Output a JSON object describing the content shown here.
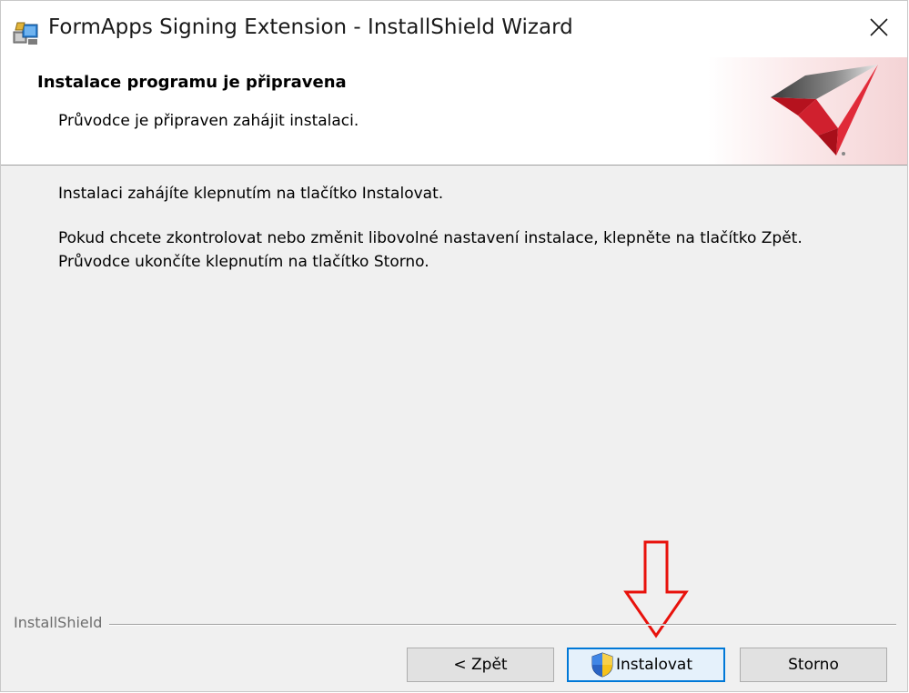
{
  "window": {
    "title": "FormApps Signing Extension - InstallShield Wizard",
    "app_icon": "installer-icon",
    "close_icon": "close-icon"
  },
  "banner": {
    "title": "Instalace programu je připravena",
    "subtitle": "Průvodce je připraven zahájit instalaci.",
    "logo": "installshield-logo"
  },
  "content": {
    "paragraph1": "Instalaci zahájíte klepnutím na tlačítko Instalovat.",
    "paragraph2_line1": "Pokud chcete zkontrolovat nebo změnit libovolné nastavení instalace, klepněte na tlačítko Zpět.",
    "paragraph2_line2": "Průvodce ukončíte klepnutím na tlačítko Storno."
  },
  "footer": {
    "brand_label": "InstallShield"
  },
  "buttons": {
    "back_label": "< Zpět",
    "install_label": "Instalovat",
    "install_icon": "uac-shield-icon",
    "cancel_label": "Storno"
  },
  "annotation": {
    "arrow_icon": "down-arrow-icon",
    "arrow_color": "#e8120c"
  },
  "colors": {
    "accent": "#0078d7",
    "logo_red": "#d0202e"
  }
}
